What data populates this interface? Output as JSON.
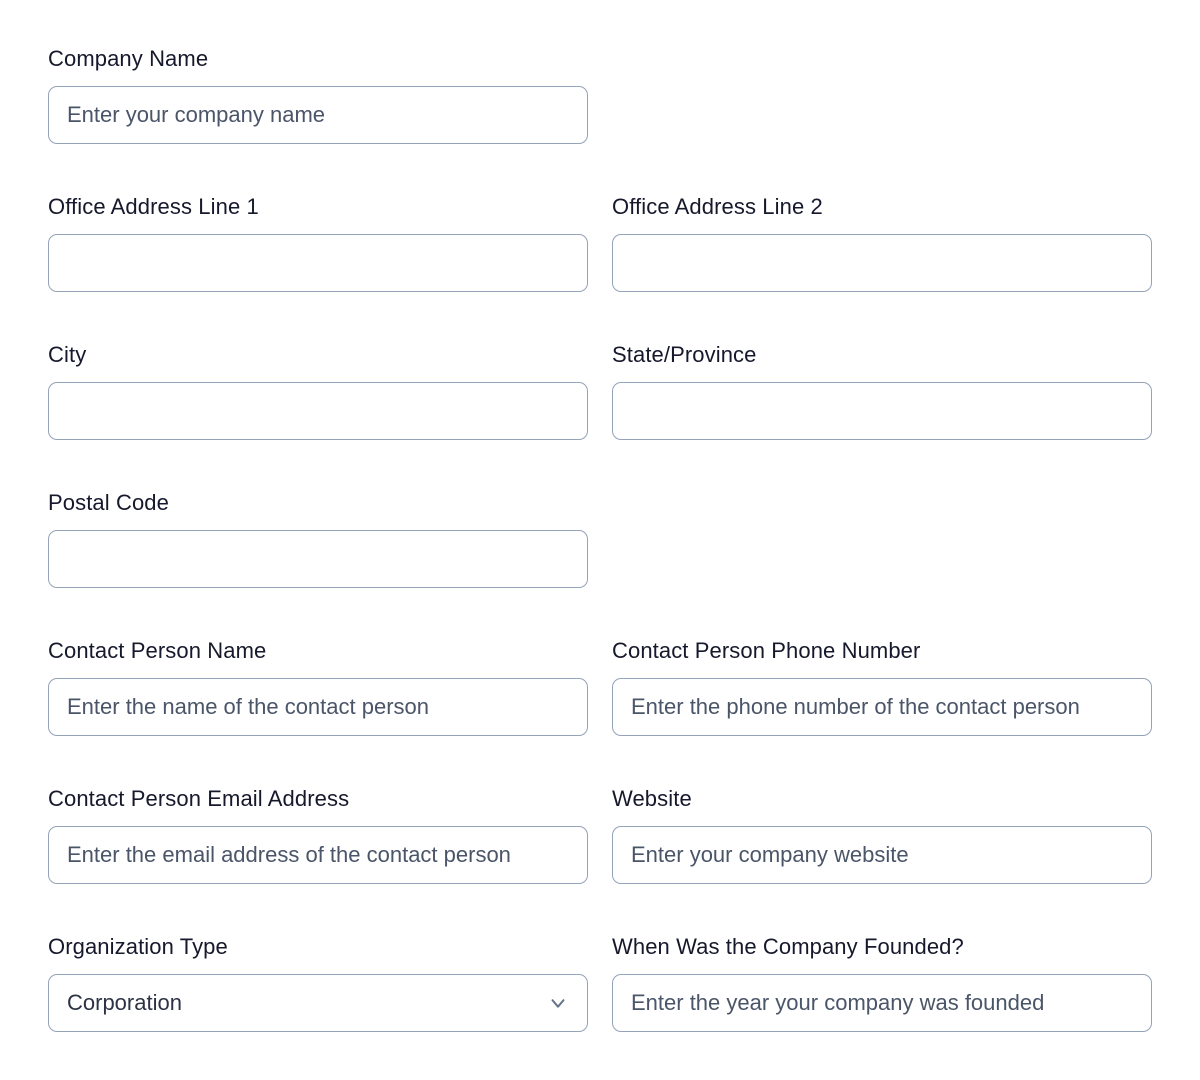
{
  "form": {
    "background_color": "#ffffff",
    "label_color": "#16182c",
    "placeholder_color": "#4a5568",
    "value_color": "#2d3344",
    "border_color": "#94a3b8",
    "icon_color": "#64748b",
    "fields": [
      {
        "name": "company-name",
        "label": "Company Name",
        "type": "text",
        "value": "",
        "placeholder": "Enter your company name",
        "column": "left"
      },
      {
        "name": "office-address-line-1",
        "label": "Office Address Line 1",
        "type": "text",
        "value": "",
        "placeholder": "",
        "column": "left"
      },
      {
        "name": "office-address-line-2",
        "label": "Office Address Line 2",
        "type": "text",
        "value": "",
        "placeholder": "",
        "column": "right"
      },
      {
        "name": "city",
        "label": "City",
        "type": "text",
        "value": "",
        "placeholder": "",
        "column": "left"
      },
      {
        "name": "state-province",
        "label": "State/Province",
        "type": "text",
        "value": "",
        "placeholder": "",
        "column": "right"
      },
      {
        "name": "postal-code",
        "label": "Postal Code",
        "type": "text",
        "value": "",
        "placeholder": "",
        "column": "left"
      },
      {
        "name": "contact-person-name",
        "label": "Contact Person Name",
        "type": "text",
        "value": "",
        "placeholder": "Enter the name of the contact person",
        "column": "left"
      },
      {
        "name": "contact-person-phone-number",
        "label": "Contact Person Phone Number",
        "type": "text",
        "value": "",
        "placeholder": "Enter the phone number of the contact person",
        "column": "right"
      },
      {
        "name": "contact-person-email-address",
        "label": "Contact Person Email Address",
        "type": "text",
        "value": "",
        "placeholder": "Enter the email address of the contact person",
        "column": "left"
      },
      {
        "name": "website",
        "label": "Website",
        "type": "text",
        "value": "",
        "placeholder": "Enter your company website",
        "column": "right"
      },
      {
        "name": "organization-type",
        "label": "Organization Type",
        "type": "select",
        "value": "Corporation",
        "placeholder": "",
        "icon": "chevron-down-icon",
        "column": "left"
      },
      {
        "name": "company-founded-year",
        "label": "When Was the Company Founded?",
        "type": "text",
        "value": "",
        "placeholder": "Enter the year your company was founded",
        "column": "right"
      }
    ]
  }
}
